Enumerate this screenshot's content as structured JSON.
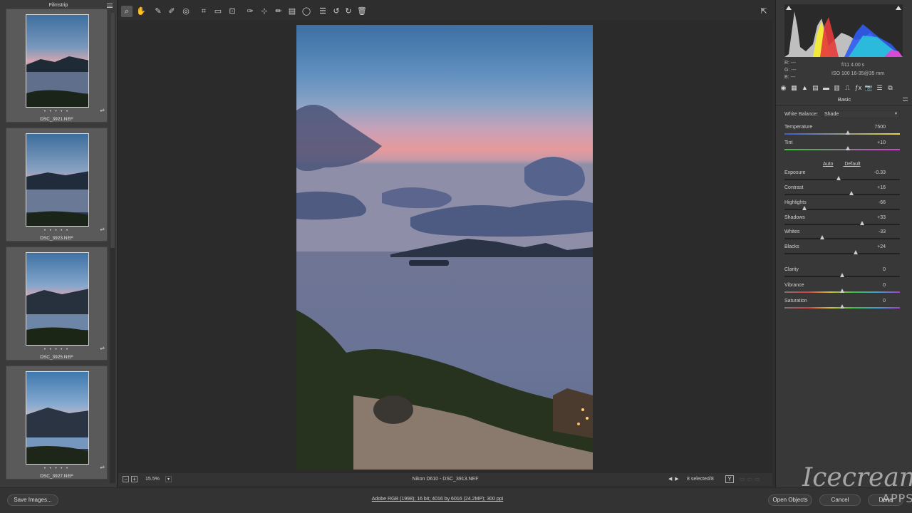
{
  "filmstrip": {
    "title": "Filmstrip",
    "items": [
      {
        "name": "DSC_3921.NEF",
        "rating": "• • • • •"
      },
      {
        "name": "DSC_3923.NEF",
        "rating": "• • • • •"
      },
      {
        "name": "DSC_3925.NEF",
        "rating": "• • • • •"
      },
      {
        "name": "DSC_3927.NEF",
        "rating": "• • • • •"
      }
    ]
  },
  "toolbar": {
    "tools": [
      "zoom-icon",
      "hand-icon",
      "white-balance-icon",
      "color-sampler-icon",
      "target-adjust-icon",
      "crop-icon",
      "straighten-icon",
      "transform-icon",
      "spot-removal-icon",
      "red-eye-icon",
      "adjustment-brush-icon",
      "graduated-filter-icon",
      "radial-filter-icon",
      "preferences-icon",
      "rotate-left-icon",
      "rotate-right-icon",
      "trash-icon"
    ]
  },
  "status": {
    "zoom": "15.5%",
    "caption": "Nikon D610  -  DSC_3913.NEF",
    "selected": "8 selected/8",
    "y_button": "Y"
  },
  "histogram": {
    "rgb_labels": [
      "R:  ---",
      "G:  ---",
      "B:  ---"
    ],
    "aperture_shutter": "f/11   4.00 s",
    "iso_lens": "ISO 100   16-35@35 mm"
  },
  "panel": {
    "title": "Basic",
    "white_balance_label": "White Balance:",
    "white_balance_value": "Shade",
    "auto": "Auto",
    "default": "Default",
    "sliders": [
      {
        "label": "Temperature",
        "value": "7500",
        "pos": 0.55
      },
      {
        "label": "Tint",
        "value": "+10",
        "pos": 0.55
      },
      {
        "label": "Exposure",
        "value": "-0.33",
        "pos": 0.47
      },
      {
        "label": "Contrast",
        "value": "+16",
        "pos": 0.58
      },
      {
        "label": "Highlights",
        "value": "-66",
        "pos": 0.17
      },
      {
        "label": "Shadows",
        "value": "+33",
        "pos": 0.67
      },
      {
        "label": "Whites",
        "value": "-33",
        "pos": 0.33
      },
      {
        "label": "Blacks",
        "value": "+24",
        "pos": 0.62
      },
      {
        "label": "Clarity",
        "value": "0",
        "pos": 0.5
      },
      {
        "label": "Vibrance",
        "value": "0",
        "pos": 0.5
      },
      {
        "label": "Saturation",
        "value": "0",
        "pos": 0.5
      }
    ]
  },
  "bottom": {
    "save_images": "Save Images...",
    "workflow": "Adobe RGB (1998); 16 bit; 4016 by 6016 (24.2MP); 300 ppi",
    "open_objects": "Open Objects",
    "cancel": "Cancel",
    "done": "Done"
  },
  "watermark": {
    "text": "Icecream",
    "sub": "APPS"
  }
}
